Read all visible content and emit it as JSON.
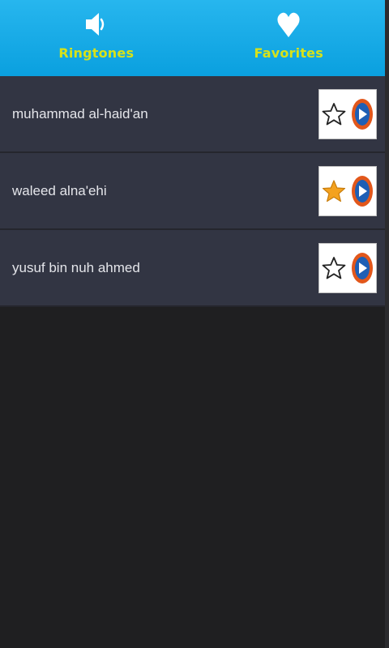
{
  "tabs": [
    {
      "label": "Ringtones",
      "icon": "speaker-icon"
    },
    {
      "label": "Favorites",
      "icon": "heart-icon"
    }
  ],
  "ringtones": [
    {
      "name": "muhammad al-haid'an",
      "favorite": false
    },
    {
      "name": "waleed alna'ehi",
      "favorite": true
    },
    {
      "name": "yusuf bin nuh ahmed",
      "favorite": false
    }
  ],
  "colors": {
    "header": "#13aae6",
    "tab_label": "#d7e21a",
    "row_bg": "#323543",
    "page_bg": "#1f1f21",
    "star_filled": "#f4a21f",
    "play_ring": "#e2571b",
    "play_center": "#1e5fb5"
  }
}
